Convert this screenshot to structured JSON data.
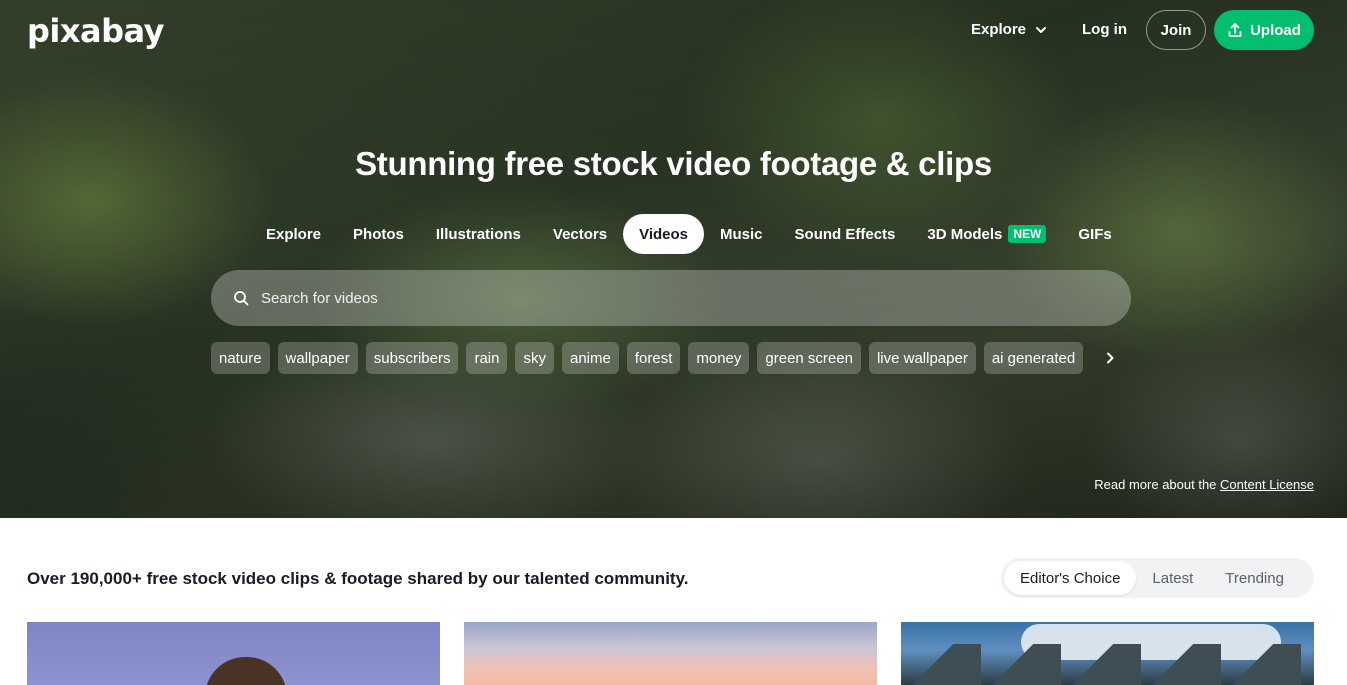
{
  "header": {
    "logo": "pixabay",
    "nav_explore": "Explore",
    "nav_login": "Log in",
    "join": "Join",
    "upload": "Upload"
  },
  "hero": {
    "headline": "Stunning free stock video footage & clips",
    "tabs": [
      {
        "label": "Explore"
      },
      {
        "label": "Photos"
      },
      {
        "label": "Illustrations"
      },
      {
        "label": "Vectors"
      },
      {
        "label": "Videos"
      },
      {
        "label": "Music"
      },
      {
        "label": "Sound Effects"
      },
      {
        "label": "3D Models"
      },
      {
        "label": "GIFs"
      }
    ],
    "new_badge": "NEW",
    "active_tab": "Videos",
    "search_placeholder": "Search for videos",
    "chips": [
      "nature",
      "wallpaper",
      "subscribers",
      "rain",
      "sky",
      "anime",
      "forest",
      "money",
      "green screen",
      "live wallpaper",
      "ai generated"
    ],
    "license_prefix": "Read more about the",
    "license_link": "Content License"
  },
  "content": {
    "subheading": "Over 190,000+ free stock video clips & footage shared by our talented community.",
    "sort_options": [
      "Editor's Choice",
      "Latest",
      "Trending"
    ],
    "sort_selected": "Editor's Choice"
  },
  "colors": {
    "accent": "#02be6e",
    "text": "#191b26"
  }
}
